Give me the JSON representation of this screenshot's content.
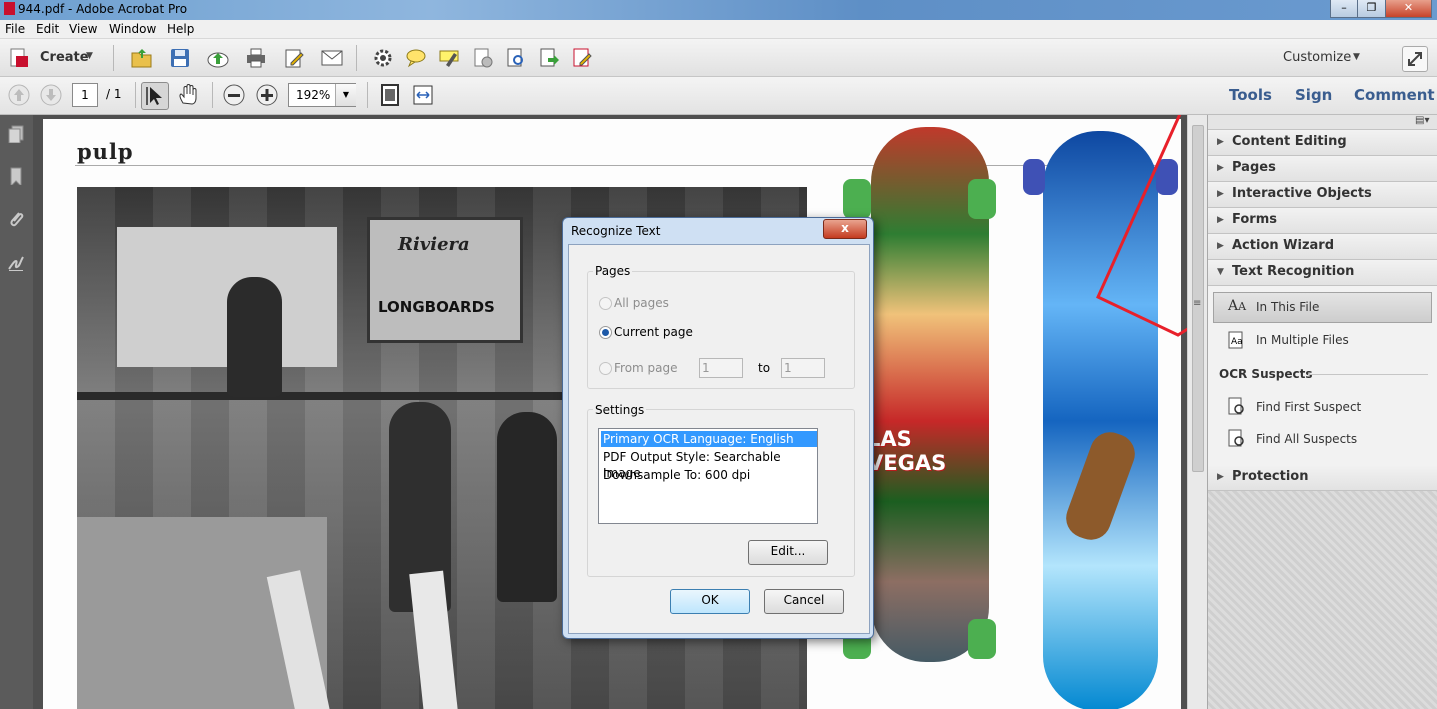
{
  "window": {
    "title": "944.pdf - Adobe Acrobat Pro"
  },
  "menu": [
    "File",
    "Edit",
    "View",
    "Window",
    "Help"
  ],
  "toolbar": {
    "create_label": "Create",
    "customize_label": "Customize"
  },
  "nav": {
    "page_current": "1",
    "page_total": "/ 1",
    "zoom": "192%"
  },
  "panel_tabs": {
    "tools": "Tools",
    "sign": "Sign",
    "comment": "Comment"
  },
  "panel": {
    "sections": [
      {
        "label": "Content Editing"
      },
      {
        "label": "Pages"
      },
      {
        "label": "Interactive Objects"
      },
      {
        "label": "Forms"
      },
      {
        "label": "Action Wizard"
      },
      {
        "label": "Text Recognition"
      }
    ],
    "text_recognition_items": [
      "In This File",
      "In Multiple Files"
    ],
    "ocr_suspects_heading": "OCR Suspects",
    "ocr_items": [
      "Find First Suspect",
      "Find All Suspects"
    ],
    "protection": "Protection"
  },
  "document": {
    "header_text": "pulp",
    "sign_text_1": "Riviera",
    "sign_text_2": "LONGBOARDS",
    "board_text": "LAS VEGAS"
  },
  "dialog": {
    "title": "Recognize Text",
    "close": "x",
    "pages_group": "Pages",
    "all_pages": "All pages",
    "current_page": "Current page",
    "from_page": "From page",
    "from_value": "1",
    "to_label": "to",
    "to_value": "1",
    "settings_group": "Settings",
    "settings": [
      "Primary OCR Language: English (US)",
      "PDF Output Style: Searchable Image",
      "Downsample To: 600 dpi"
    ],
    "edit_button": "Edit...",
    "ok_button": "OK",
    "cancel_button": "Cancel"
  },
  "colors": {
    "accent_link": "#3a5d8f",
    "selection": "#3399ff",
    "annotation": "#e8202a"
  }
}
